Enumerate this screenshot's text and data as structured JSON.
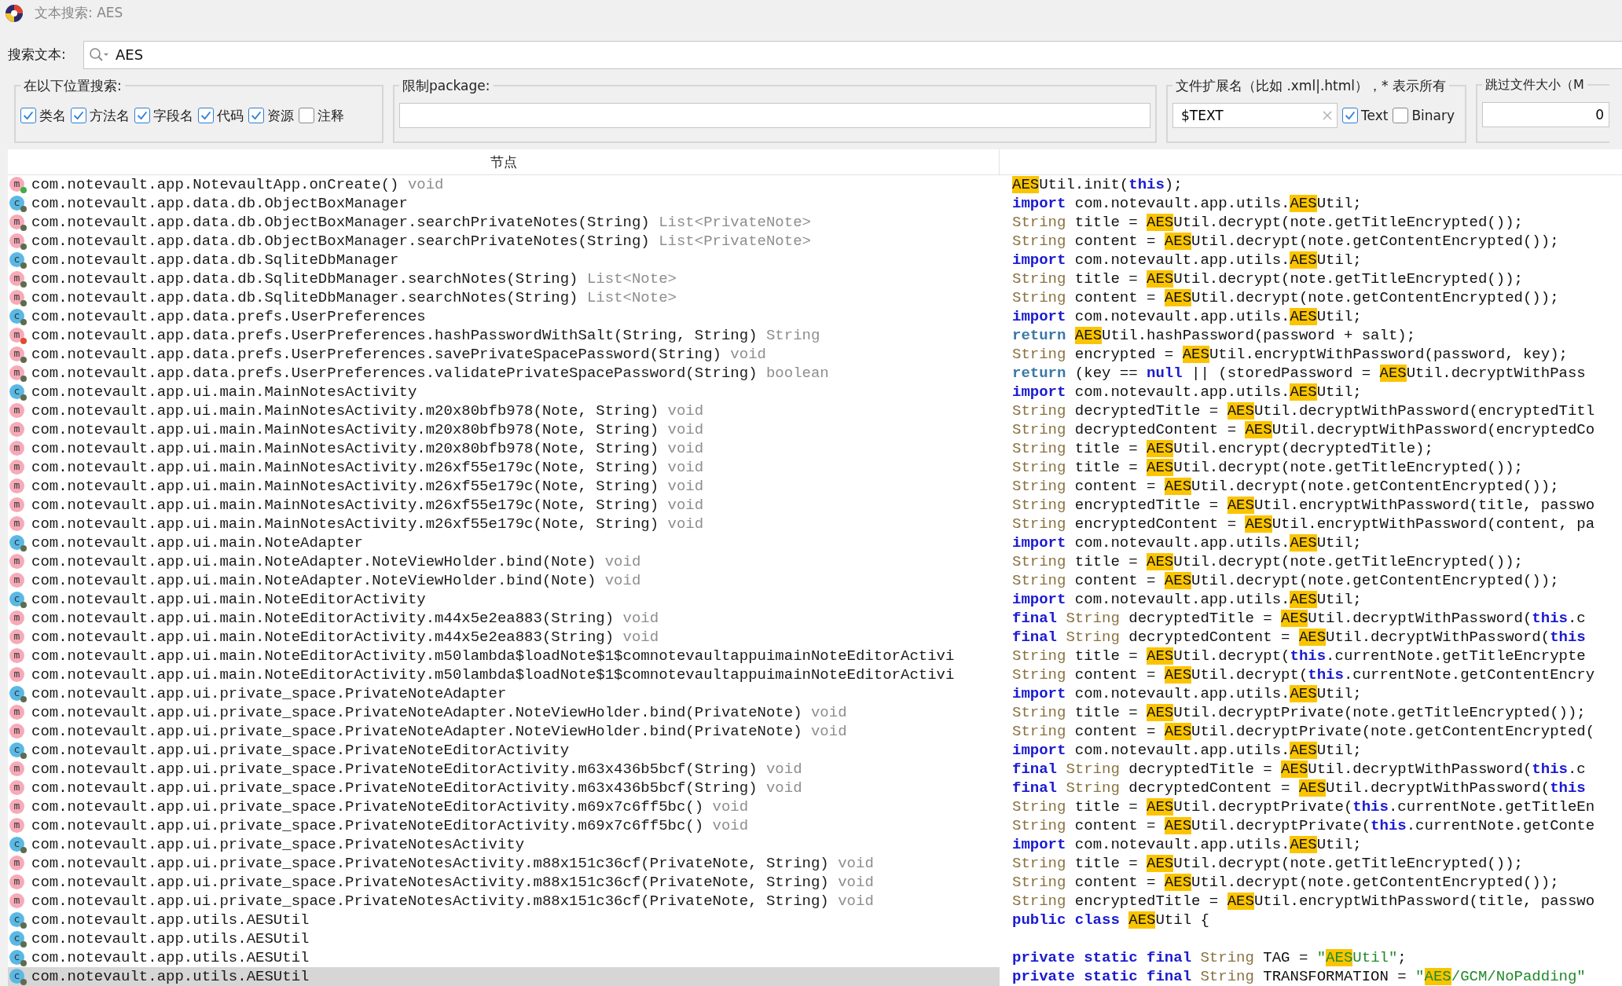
{
  "window": {
    "title": "文本搜索: AES"
  },
  "search": {
    "label": "搜索文本:",
    "value": "AES"
  },
  "search_in": {
    "legend": "在以下位置搜索:",
    "options": [
      {
        "label": "类名",
        "checked": true
      },
      {
        "label": "方法名",
        "checked": true
      },
      {
        "label": "字段名",
        "checked": true
      },
      {
        "label": "代码",
        "checked": true
      },
      {
        "label": "资源",
        "checked": true
      },
      {
        "label": "注释",
        "checked": false
      }
    ]
  },
  "package_filter": {
    "legend": "限制package:"
  },
  "file_extensions": {
    "legend": "文件扩展名（比如 .xml|.html），* 表示所有",
    "value": "$TEXT",
    "options": [
      {
        "label": "Text",
        "checked": true
      },
      {
        "label": "Binary",
        "checked": false
      }
    ]
  },
  "skip_file_size": {
    "legend": "跳过文件大小（M",
    "value": "0"
  },
  "results": {
    "columns": [
      "节点"
    ],
    "rows": [
      {
        "icon": "m",
        "color": "#3cb043",
        "label": [
          {
            "kind": "name",
            "text": "com.notevault.app.NotevaultApp.onCreate() "
          },
          {
            "kind": "type",
            "text": "void"
          }
        ],
        "selected": false,
        "code": [
          {
            "kind": "hl",
            "text": "AES"
          },
          {
            "kind": "plain",
            "text": "Util.init("
          },
          {
            "kind": "kw",
            "text": "this"
          },
          {
            "kind": "plain",
            "text": ");"
          }
        ]
      },
      {
        "icon": "c",
        "color": "#5f6b4e",
        "label": [
          {
            "kind": "name",
            "text": "com.notevault.app.data.db.ObjectBoxManager"
          }
        ],
        "selected": false,
        "code": [
          {
            "kind": "kw",
            "text": "import"
          },
          {
            "kind": "plain",
            "text": " com.notevault.app.utils."
          },
          {
            "kind": "hl",
            "text": "AES"
          },
          {
            "kind": "plain",
            "text": "Util;"
          }
        ]
      },
      {
        "icon": "m",
        "color": "#5f6b4e",
        "label": [
          {
            "kind": "name",
            "text": "com.notevault.app.data.db.ObjectBoxManager.searchPrivateNotes(String) "
          },
          {
            "kind": "type",
            "text": "List<PrivateNote>"
          }
        ],
        "selected": false,
        "code": [
          {
            "kind": "type",
            "text": "String"
          },
          {
            "kind": "plain",
            "text": " title = "
          },
          {
            "kind": "hl",
            "text": "AES"
          },
          {
            "kind": "plain",
            "text": "Util.decrypt(note.getTitleEncrypted());"
          }
        ]
      },
      {
        "icon": "m",
        "color": "#5f6b4e",
        "label": [
          {
            "kind": "name",
            "text": "com.notevault.app.data.db.ObjectBoxManager.searchPrivateNotes(String) "
          },
          {
            "kind": "type",
            "text": "List<PrivateNote>"
          }
        ],
        "selected": false,
        "code": [
          {
            "kind": "type",
            "text": "String"
          },
          {
            "kind": "plain",
            "text": " content = "
          },
          {
            "kind": "hl",
            "text": "AES"
          },
          {
            "kind": "plain",
            "text": "Util.decrypt(note.getContentEncrypted());"
          }
        ]
      },
      {
        "icon": "c",
        "color": "#5f6b4e",
        "label": [
          {
            "kind": "name",
            "text": "com.notevault.app.data.db.SqliteDbManager"
          }
        ],
        "selected": false,
        "code": [
          {
            "kind": "kw",
            "text": "import"
          },
          {
            "kind": "plain",
            "text": " com.notevault.app.utils."
          },
          {
            "kind": "hl",
            "text": "AES"
          },
          {
            "kind": "plain",
            "text": "Util;"
          }
        ]
      },
      {
        "icon": "m",
        "color": "#5f6b4e",
        "label": [
          {
            "kind": "name",
            "text": "com.notevault.app.data.db.SqliteDbManager.searchNotes(String) "
          },
          {
            "kind": "type",
            "text": "List<Note>"
          }
        ],
        "selected": false,
        "code": [
          {
            "kind": "type",
            "text": "String"
          },
          {
            "kind": "plain",
            "text": " title = "
          },
          {
            "kind": "hl",
            "text": "AES"
          },
          {
            "kind": "plain",
            "text": "Util.decrypt(note.getTitleEncrypted());"
          }
        ]
      },
      {
        "icon": "m",
        "color": "#5f6b4e",
        "label": [
          {
            "kind": "name",
            "text": "com.notevault.app.data.db.SqliteDbManager.searchNotes(String) "
          },
          {
            "kind": "type",
            "text": "List<Note>"
          }
        ],
        "selected": false,
        "code": [
          {
            "kind": "type",
            "text": "String"
          },
          {
            "kind": "plain",
            "text": " content = "
          },
          {
            "kind": "hl",
            "text": "AES"
          },
          {
            "kind": "plain",
            "text": "Util.decrypt(note.getContentEncrypted());"
          }
        ]
      },
      {
        "icon": "c",
        "color": "#5f6b4e",
        "label": [
          {
            "kind": "name",
            "text": "com.notevault.app.data.prefs.UserPreferences"
          }
        ],
        "selected": false,
        "code": [
          {
            "kind": "kw",
            "text": "import"
          },
          {
            "kind": "plain",
            "text": " com.notevault.app.utils."
          },
          {
            "kind": "hl",
            "text": "AES"
          },
          {
            "kind": "plain",
            "text": "Util;"
          }
        ]
      },
      {
        "icon": "m",
        "color": "#e2492f",
        "label": [
          {
            "kind": "name",
            "text": "com.notevault.app.data.prefs.UserPreferences.hashPasswordWithSalt(String, String) "
          },
          {
            "kind": "type",
            "text": "String"
          }
        ],
        "selected": false,
        "code": [
          {
            "kind": "ret",
            "text": "return "
          },
          {
            "kind": "hl",
            "text": "AES"
          },
          {
            "kind": "plain",
            "text": "Util.hashPassword(password + salt);"
          }
        ]
      },
      {
        "icon": "m",
        "color": "#5f6b4e",
        "label": [
          {
            "kind": "name",
            "text": "com.notevault.app.data.prefs.UserPreferences.savePrivateSpacePassword(String) "
          },
          {
            "kind": "type",
            "text": "void"
          }
        ],
        "selected": false,
        "code": [
          {
            "kind": "type",
            "text": "String"
          },
          {
            "kind": "plain",
            "text": " encrypted = "
          },
          {
            "kind": "hl",
            "text": "AES"
          },
          {
            "kind": "plain",
            "text": "Util.encryptWithPassword(password, key);"
          }
        ]
      },
      {
        "icon": "m",
        "color": "#5f6b4e",
        "label": [
          {
            "kind": "name",
            "text": "com.notevault.app.data.prefs.UserPreferences.validatePrivateSpacePassword(String) "
          },
          {
            "kind": "type",
            "text": "boolean"
          }
        ],
        "selected": false,
        "code": [
          {
            "kind": "ret",
            "text": "return"
          },
          {
            "kind": "plain",
            "text": " (key == "
          },
          {
            "kind": "kw",
            "text": "null"
          },
          {
            "kind": "plain",
            "text": " || (storedPassword = "
          },
          {
            "kind": "hl",
            "text": "AES"
          },
          {
            "kind": "plain",
            "text": "Util.decryptWithPass"
          }
        ]
      },
      {
        "icon": "c",
        "color": "#5f6b4e",
        "label": [
          {
            "kind": "name",
            "text": "com.notevault.app.ui.main.MainNotesActivity"
          }
        ],
        "selected": false,
        "code": [
          {
            "kind": "kw",
            "text": "import"
          },
          {
            "kind": "plain",
            "text": " com.notevault.app.utils."
          },
          {
            "kind": "hl",
            "text": "AES"
          },
          {
            "kind": "plain",
            "text": "Util;"
          }
        ]
      },
      {
        "icon": "m",
        "label": [
          {
            "kind": "name",
            "text": "com.notevault.app.ui.main.MainNotesActivity.m20x80bfb978(Note, String) "
          },
          {
            "kind": "type",
            "text": "void"
          }
        ],
        "selected": false,
        "code": [
          {
            "kind": "type",
            "text": "String"
          },
          {
            "kind": "plain",
            "text": " decryptedTitle = "
          },
          {
            "kind": "hl",
            "text": "AES"
          },
          {
            "kind": "plain",
            "text": "Util.decryptWithPassword(encryptedTitl"
          }
        ]
      },
      {
        "icon": "m",
        "label": [
          {
            "kind": "name",
            "text": "com.notevault.app.ui.main.MainNotesActivity.m20x80bfb978(Note, String) "
          },
          {
            "kind": "type",
            "text": "void"
          }
        ],
        "selected": false,
        "code": [
          {
            "kind": "type",
            "text": "String"
          },
          {
            "kind": "plain",
            "text": " decryptedContent = "
          },
          {
            "kind": "hl",
            "text": "AES"
          },
          {
            "kind": "plain",
            "text": "Util.decryptWithPassword(encryptedCo"
          }
        ]
      },
      {
        "icon": "m",
        "label": [
          {
            "kind": "name",
            "text": "com.notevault.app.ui.main.MainNotesActivity.m20x80bfb978(Note, String) "
          },
          {
            "kind": "type",
            "text": "void"
          }
        ],
        "selected": false,
        "code": [
          {
            "kind": "type",
            "text": "String"
          },
          {
            "kind": "plain",
            "text": " title = "
          },
          {
            "kind": "hl",
            "text": "AES"
          },
          {
            "kind": "plain",
            "text": "Util.encrypt(decryptedTitle);"
          }
        ]
      },
      {
        "icon": "m",
        "label": [
          {
            "kind": "name",
            "text": "com.notevault.app.ui.main.MainNotesActivity.m26xf55e179c(Note, String) "
          },
          {
            "kind": "type",
            "text": "void"
          }
        ],
        "selected": false,
        "code": [
          {
            "kind": "type",
            "text": "String"
          },
          {
            "kind": "plain",
            "text": " title = "
          },
          {
            "kind": "hl",
            "text": "AES"
          },
          {
            "kind": "plain",
            "text": "Util.decrypt(note.getTitleEncrypted());"
          }
        ]
      },
      {
        "icon": "m",
        "label": [
          {
            "kind": "name",
            "text": "com.notevault.app.ui.main.MainNotesActivity.m26xf55e179c(Note, String) "
          },
          {
            "kind": "type",
            "text": "void"
          }
        ],
        "selected": false,
        "code": [
          {
            "kind": "type",
            "text": "String"
          },
          {
            "kind": "plain",
            "text": " content = "
          },
          {
            "kind": "hl",
            "text": "AES"
          },
          {
            "kind": "plain",
            "text": "Util.decrypt(note.getContentEncrypted());"
          }
        ]
      },
      {
        "icon": "m",
        "label": [
          {
            "kind": "name",
            "text": "com.notevault.app.ui.main.MainNotesActivity.m26xf55e179c(Note, String) "
          },
          {
            "kind": "type",
            "text": "void"
          }
        ],
        "selected": false,
        "code": [
          {
            "kind": "type",
            "text": "String"
          },
          {
            "kind": "plain",
            "text": " encryptedTitle = "
          },
          {
            "kind": "hl",
            "text": "AES"
          },
          {
            "kind": "plain",
            "text": "Util.encryptWithPassword(title, passwo"
          }
        ]
      },
      {
        "icon": "m",
        "label": [
          {
            "kind": "name",
            "text": "com.notevault.app.ui.main.MainNotesActivity.m26xf55e179c(Note, String) "
          },
          {
            "kind": "type",
            "text": "void"
          }
        ],
        "selected": false,
        "code": [
          {
            "kind": "type",
            "text": "String"
          },
          {
            "kind": "plain",
            "text": " encryptedContent = "
          },
          {
            "kind": "hl",
            "text": "AES"
          },
          {
            "kind": "plain",
            "text": "Util.encryptWithPassword(content, pa"
          }
        ]
      },
      {
        "icon": "c",
        "color": "#5f6b4e",
        "label": [
          {
            "kind": "name",
            "text": "com.notevault.app.ui.main.NoteAdapter"
          }
        ],
        "selected": false,
        "code": [
          {
            "kind": "kw",
            "text": "import"
          },
          {
            "kind": "plain",
            "text": " com.notevault.app.utils."
          },
          {
            "kind": "hl",
            "text": "AES"
          },
          {
            "kind": "plain",
            "text": "Util;"
          }
        ]
      },
      {
        "icon": "m",
        "label": [
          {
            "kind": "name",
            "text": "com.notevault.app.ui.main.NoteAdapter.NoteViewHolder.bind(Note) "
          },
          {
            "kind": "type",
            "text": "void"
          }
        ],
        "selected": false,
        "code": [
          {
            "kind": "type",
            "text": "String"
          },
          {
            "kind": "plain",
            "text": " title = "
          },
          {
            "kind": "hl",
            "text": "AES"
          },
          {
            "kind": "plain",
            "text": "Util.decrypt(note.getTitleEncrypted());"
          }
        ]
      },
      {
        "icon": "m",
        "label": [
          {
            "kind": "name",
            "text": "com.notevault.app.ui.main.NoteAdapter.NoteViewHolder.bind(Note) "
          },
          {
            "kind": "type",
            "text": "void"
          }
        ],
        "selected": false,
        "code": [
          {
            "kind": "type",
            "text": "String"
          },
          {
            "kind": "plain",
            "text": " content = "
          },
          {
            "kind": "hl",
            "text": "AES"
          },
          {
            "kind": "plain",
            "text": "Util.decrypt(note.getContentEncrypted());"
          }
        ]
      },
      {
        "icon": "c",
        "color": "#5f6b4e",
        "label": [
          {
            "kind": "name",
            "text": "com.notevault.app.ui.main.NoteEditorActivity"
          }
        ],
        "selected": false,
        "code": [
          {
            "kind": "kw",
            "text": "import"
          },
          {
            "kind": "plain",
            "text": " com.notevault.app.utils."
          },
          {
            "kind": "hl",
            "text": "AES"
          },
          {
            "kind": "plain",
            "text": "Util;"
          }
        ]
      },
      {
        "icon": "m",
        "label": [
          {
            "kind": "name",
            "text": "com.notevault.app.ui.main.NoteEditorActivity.m44x5e2ea883(String) "
          },
          {
            "kind": "type",
            "text": "void"
          }
        ],
        "selected": false,
        "code": [
          {
            "kind": "kw",
            "text": "final"
          },
          {
            "kind": "type",
            "text": " String"
          },
          {
            "kind": "plain",
            "text": " decryptedTitle = "
          },
          {
            "kind": "hl",
            "text": "AES"
          },
          {
            "kind": "plain",
            "text": "Util.decryptWithPassword("
          },
          {
            "kind": "kw",
            "text": "this"
          },
          {
            "kind": "plain",
            "text": ".c"
          }
        ]
      },
      {
        "icon": "m",
        "label": [
          {
            "kind": "name",
            "text": "com.notevault.app.ui.main.NoteEditorActivity.m44x5e2ea883(String) "
          },
          {
            "kind": "type",
            "text": "void"
          }
        ],
        "selected": false,
        "code": [
          {
            "kind": "kw",
            "text": "final"
          },
          {
            "kind": "type",
            "text": " String"
          },
          {
            "kind": "plain",
            "text": " decryptedContent = "
          },
          {
            "kind": "hl",
            "text": "AES"
          },
          {
            "kind": "plain",
            "text": "Util.decryptWithPassword("
          },
          {
            "kind": "kw",
            "text": "this"
          }
        ]
      },
      {
        "icon": "m",
        "label": [
          {
            "kind": "name",
            "text": "com.notevault.app.ui.main.NoteEditorActivity.m50lambda$loadNote$1$comnotevaultappuimainNoteEditorActivi"
          }
        ],
        "selected": false,
        "code": [
          {
            "kind": "type",
            "text": "String"
          },
          {
            "kind": "plain",
            "text": " title = "
          },
          {
            "kind": "hl",
            "text": "AES"
          },
          {
            "kind": "plain",
            "text": "Util.decrypt("
          },
          {
            "kind": "kw",
            "text": "this"
          },
          {
            "kind": "plain",
            "text": ".currentNote.getTitleEncrypte"
          }
        ]
      },
      {
        "icon": "m",
        "label": [
          {
            "kind": "name",
            "text": "com.notevault.app.ui.main.NoteEditorActivity.m50lambda$loadNote$1$comnotevaultappuimainNoteEditorActivi"
          }
        ],
        "selected": false,
        "code": [
          {
            "kind": "type",
            "text": "String"
          },
          {
            "kind": "plain",
            "text": " content = "
          },
          {
            "kind": "hl",
            "text": "AES"
          },
          {
            "kind": "plain",
            "text": "Util.decrypt("
          },
          {
            "kind": "kw",
            "text": "this"
          },
          {
            "kind": "plain",
            "text": ".currentNote.getContentEncry"
          }
        ]
      },
      {
        "icon": "c",
        "color": "#5f6b4e",
        "label": [
          {
            "kind": "name",
            "text": "com.notevault.app.ui.private_space.PrivateNoteAdapter"
          }
        ],
        "selected": false,
        "code": [
          {
            "kind": "kw",
            "text": "import"
          },
          {
            "kind": "plain",
            "text": " com.notevault.app.utils."
          },
          {
            "kind": "hl",
            "text": "AES"
          },
          {
            "kind": "plain",
            "text": "Util;"
          }
        ]
      },
      {
        "icon": "m",
        "label": [
          {
            "kind": "name",
            "text": "com.notevault.app.ui.private_space.PrivateNoteAdapter.NoteViewHolder.bind(PrivateNote) "
          },
          {
            "kind": "type",
            "text": "void"
          }
        ],
        "selected": false,
        "code": [
          {
            "kind": "type",
            "text": "String"
          },
          {
            "kind": "plain",
            "text": " title = "
          },
          {
            "kind": "hl",
            "text": "AES"
          },
          {
            "kind": "plain",
            "text": "Util.decryptPrivate(note.getTitleEncrypted());"
          }
        ]
      },
      {
        "icon": "m",
        "label": [
          {
            "kind": "name",
            "text": "com.notevault.app.ui.private_space.PrivateNoteAdapter.NoteViewHolder.bind(PrivateNote) "
          },
          {
            "kind": "type",
            "text": "void"
          }
        ],
        "selected": false,
        "code": [
          {
            "kind": "type",
            "text": "String"
          },
          {
            "kind": "plain",
            "text": " content = "
          },
          {
            "kind": "hl",
            "text": "AES"
          },
          {
            "kind": "plain",
            "text": "Util.decryptPrivate(note.getContentEncrypted("
          }
        ]
      },
      {
        "icon": "c",
        "color": "#5f6b4e",
        "label": [
          {
            "kind": "name",
            "text": "com.notevault.app.ui.private_space.PrivateNoteEditorActivity"
          }
        ],
        "selected": false,
        "code": [
          {
            "kind": "kw",
            "text": "import"
          },
          {
            "kind": "plain",
            "text": " com.notevault.app.utils."
          },
          {
            "kind": "hl",
            "text": "AES"
          },
          {
            "kind": "plain",
            "text": "Util;"
          }
        ]
      },
      {
        "icon": "m",
        "label": [
          {
            "kind": "name",
            "text": "com.notevault.app.ui.private_space.PrivateNoteEditorActivity.m63x436b5bcf(String) "
          },
          {
            "kind": "type",
            "text": "void"
          }
        ],
        "selected": false,
        "code": [
          {
            "kind": "kw",
            "text": "final"
          },
          {
            "kind": "type",
            "text": " String"
          },
          {
            "kind": "plain",
            "text": " decryptedTitle = "
          },
          {
            "kind": "hl",
            "text": "AES"
          },
          {
            "kind": "plain",
            "text": "Util.decryptWithPassword("
          },
          {
            "kind": "kw",
            "text": "this"
          },
          {
            "kind": "plain",
            "text": ".c"
          }
        ]
      },
      {
        "icon": "m",
        "label": [
          {
            "kind": "name",
            "text": "com.notevault.app.ui.private_space.PrivateNoteEditorActivity.m63x436b5bcf(String) "
          },
          {
            "kind": "type",
            "text": "void"
          }
        ],
        "selected": false,
        "code": [
          {
            "kind": "kw",
            "text": "final"
          },
          {
            "kind": "type",
            "text": " String"
          },
          {
            "kind": "plain",
            "text": " decryptedContent = "
          },
          {
            "kind": "hl",
            "text": "AES"
          },
          {
            "kind": "plain",
            "text": "Util.decryptWithPassword("
          },
          {
            "kind": "kw",
            "text": "this"
          }
        ]
      },
      {
        "icon": "m",
        "label": [
          {
            "kind": "name",
            "text": "com.notevault.app.ui.private_space.PrivateNoteEditorActivity.m69x7c6ff5bc() "
          },
          {
            "kind": "type",
            "text": "void"
          }
        ],
        "selected": false,
        "code": [
          {
            "kind": "type",
            "text": "String"
          },
          {
            "kind": "plain",
            "text": " title = "
          },
          {
            "kind": "hl",
            "text": "AES"
          },
          {
            "kind": "plain",
            "text": "Util.decryptPrivate("
          },
          {
            "kind": "kw",
            "text": "this"
          },
          {
            "kind": "plain",
            "text": ".currentNote.getTitleEn"
          }
        ]
      },
      {
        "icon": "m",
        "label": [
          {
            "kind": "name",
            "text": "com.notevault.app.ui.private_space.PrivateNoteEditorActivity.m69x7c6ff5bc() "
          },
          {
            "kind": "type",
            "text": "void"
          }
        ],
        "selected": false,
        "code": [
          {
            "kind": "type",
            "text": "String"
          },
          {
            "kind": "plain",
            "text": " content = "
          },
          {
            "kind": "hl",
            "text": "AES"
          },
          {
            "kind": "plain",
            "text": "Util.decryptPrivate("
          },
          {
            "kind": "kw",
            "text": "this"
          },
          {
            "kind": "plain",
            "text": ".currentNote.getConte"
          }
        ]
      },
      {
        "icon": "c",
        "color": "#5f6b4e",
        "label": [
          {
            "kind": "name",
            "text": "com.notevault.app.ui.private_space.PrivateNotesActivity"
          }
        ],
        "selected": false,
        "code": [
          {
            "kind": "kw",
            "text": "import"
          },
          {
            "kind": "plain",
            "text": " com.notevault.app.utils."
          },
          {
            "kind": "hl",
            "text": "AES"
          },
          {
            "kind": "plain",
            "text": "Util;"
          }
        ]
      },
      {
        "icon": "m",
        "label": [
          {
            "kind": "name",
            "text": "com.notevault.app.ui.private_space.PrivateNotesActivity.m88x151c36cf(PrivateNote, String) "
          },
          {
            "kind": "type",
            "text": "void"
          }
        ],
        "selected": false,
        "code": [
          {
            "kind": "type",
            "text": "String"
          },
          {
            "kind": "plain",
            "text": " title = "
          },
          {
            "kind": "hl",
            "text": "AES"
          },
          {
            "kind": "plain",
            "text": "Util.decrypt(note.getTitleEncrypted());"
          }
        ]
      },
      {
        "icon": "m",
        "label": [
          {
            "kind": "name",
            "text": "com.notevault.app.ui.private_space.PrivateNotesActivity.m88x151c36cf(PrivateNote, String) "
          },
          {
            "kind": "type",
            "text": "void"
          }
        ],
        "selected": false,
        "code": [
          {
            "kind": "type",
            "text": "String"
          },
          {
            "kind": "plain",
            "text": " content = "
          },
          {
            "kind": "hl",
            "text": "AES"
          },
          {
            "kind": "plain",
            "text": "Util.decrypt(note.getContentEncrypted());"
          }
        ]
      },
      {
        "icon": "m",
        "label": [
          {
            "kind": "name",
            "text": "com.notevault.app.ui.private_space.PrivateNotesActivity.m88x151c36cf(PrivateNote, String) "
          },
          {
            "kind": "type",
            "text": "void"
          }
        ],
        "selected": false,
        "code": [
          {
            "kind": "type",
            "text": "String"
          },
          {
            "kind": "plain",
            "text": " encryptedTitle = "
          },
          {
            "kind": "hl",
            "text": "AES"
          },
          {
            "kind": "plain",
            "text": "Util.encryptWithPassword(title, passwo"
          }
        ]
      },
      {
        "icon": "c",
        "color": "#5f6b4e",
        "label": [
          {
            "kind": "name",
            "text": "com.notevault.app.utils.AESUtil"
          }
        ],
        "selected": false,
        "code": [
          {
            "kind": "kw",
            "text": "public class "
          },
          {
            "kind": "hl",
            "text": "AES"
          },
          {
            "kind": "plain",
            "text": "Util {"
          }
        ]
      },
      {
        "icon": "c",
        "color": "#5f6b4e",
        "label": [
          {
            "kind": "name",
            "text": "com.notevault.app.utils.AESUtil"
          }
        ],
        "selected": false
      },
      {
        "icon": "c",
        "color": "#5f6b4e",
        "label": [
          {
            "kind": "name",
            "text": "com.notevault.app.utils.AESUtil"
          }
        ],
        "selected": false,
        "code": [
          {
            "kind": "kw",
            "text": "private static final"
          },
          {
            "kind": "type",
            "text": " String"
          },
          {
            "kind": "plain",
            "text": " TAG = "
          },
          {
            "kind": "str",
            "text": "\""
          },
          {
            "kind": "hlstr",
            "text": "AES"
          },
          {
            "kind": "str",
            "text": "Util\""
          },
          {
            "kind": "plain",
            "text": ";"
          }
        ]
      },
      {
        "icon": "c",
        "color": "#5f6b4e",
        "label": [
          {
            "kind": "name",
            "text": "com.notevault.app.utils.AESUtil"
          }
        ],
        "selected": true,
        "code": [
          {
            "kind": "kw",
            "text": "private static final"
          },
          {
            "kind": "type",
            "text": " String"
          },
          {
            "kind": "plain",
            "text": " TRANSFORMATION = "
          },
          {
            "kind": "str",
            "text": "\""
          },
          {
            "kind": "hlstr",
            "text": "AES"
          },
          {
            "kind": "str",
            "text": "/GCM/NoPadding\""
          }
        ]
      }
    ]
  }
}
